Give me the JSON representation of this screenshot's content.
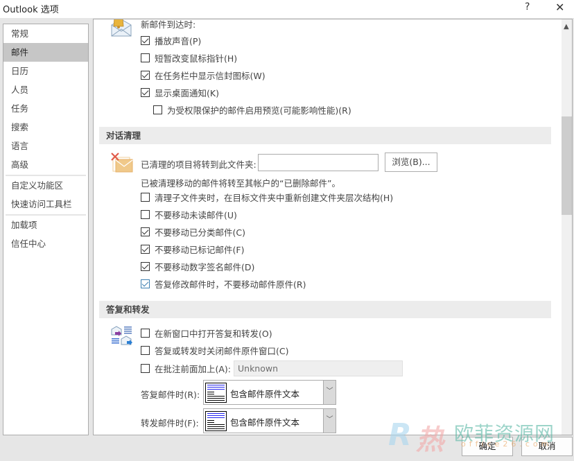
{
  "window": {
    "title": "Outlook 选项",
    "help_label": "?",
    "close_label": "✕"
  },
  "sidebar": {
    "items": [
      {
        "label": "常规",
        "selected": false
      },
      {
        "label": "邮件",
        "selected": true
      },
      {
        "label": "日历",
        "selected": false
      },
      {
        "label": "人员",
        "selected": false
      },
      {
        "label": "任务",
        "selected": false
      },
      {
        "label": "搜索",
        "selected": false
      },
      {
        "label": "语言",
        "selected": false
      },
      {
        "label": "高级",
        "selected": false
      },
      {
        "label": "自定义功能区",
        "selected": false
      },
      {
        "label": "快速访问工具栏",
        "selected": false
      },
      {
        "label": "加载项",
        "selected": false
      },
      {
        "label": "信任中心",
        "selected": false
      }
    ]
  },
  "new_mail": {
    "heading_partial": "新邮件到达时:",
    "icon": "bell-envelope-icon",
    "options": [
      {
        "label": "播放声音(P)",
        "checked": true
      },
      {
        "label": "短暂改变鼠标指针(H)",
        "checked": false
      },
      {
        "label": "在任务栏中显示信封图标(W)",
        "checked": true
      },
      {
        "label": "显示桌面通知(K)",
        "checked": true
      },
      {
        "label": "为受权限保护的邮件启用预览(可能影响性能)(R)",
        "checked": false
      }
    ]
  },
  "cleanup": {
    "header": "对话清理",
    "icon": "cleanup-envelope-icon",
    "folder_label": "已清理的项目将转到此文件夹:",
    "folder_value": "",
    "browse_label": "浏览(B)...",
    "note": "已被清理移动的邮件将转至其帐户的“已删除邮件”。",
    "options": [
      {
        "label": "清理子文件夹时，在目标文件夹中重新创建文件夹层次结构(H)",
        "checked": false
      },
      {
        "label": "不要移动未读邮件(U)",
        "checked": false
      },
      {
        "label": "不要移动已分类邮件(C)",
        "checked": true
      },
      {
        "label": "不要移动已标记邮件(F)",
        "checked": true
      },
      {
        "label": "不要移动数字签名邮件(D)",
        "checked": true
      },
      {
        "label": "答复修改邮件时，不要移动邮件原件(R)",
        "checked": true
      }
    ]
  },
  "reply_forward": {
    "header": "答复和转发",
    "icon": "reply-forward-icon",
    "options": [
      {
        "label": "在新窗口中打开答复和转发(O)",
        "checked": false
      },
      {
        "label": "答复或转发时关闭邮件原件窗口(C)",
        "checked": false
      },
      {
        "label": "在批注前面加上(A):",
        "checked": false
      }
    ],
    "annotation_value": "Unknown",
    "reply_label": "答复邮件时(R):",
    "reply_value": "包含邮件原件文本",
    "forward_label": "转发邮件时(F):",
    "forward_value": "包含邮件原件文本"
  },
  "footer": {
    "ok_label": "确定",
    "cancel_label": "取消"
  },
  "watermark": {
    "text": "欧菲资源网",
    "subtext": "office26.com"
  }
}
